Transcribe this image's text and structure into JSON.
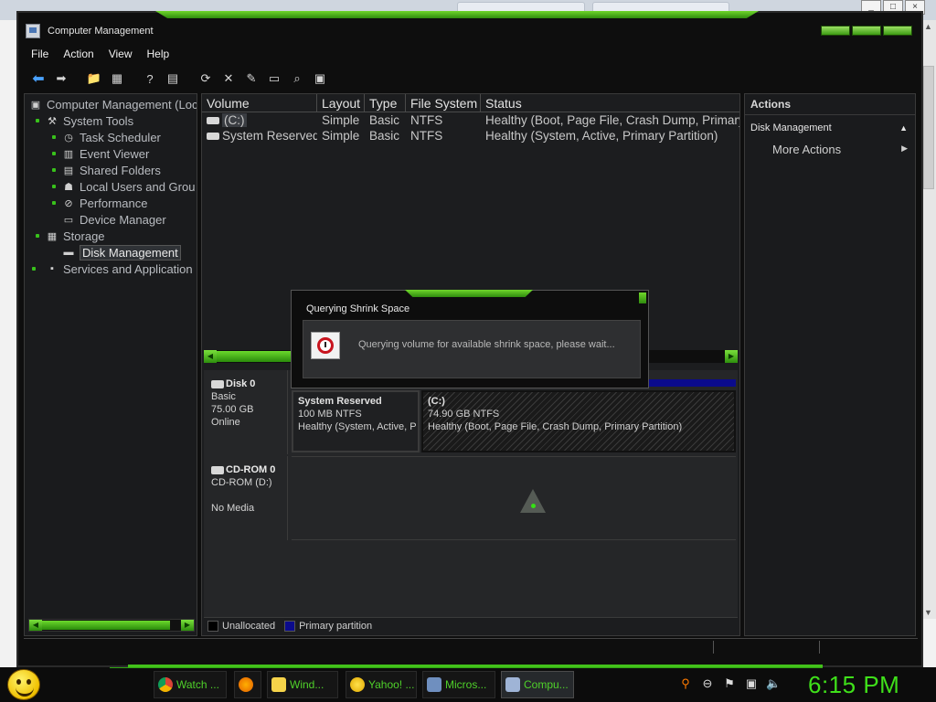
{
  "window": {
    "title": "Computer Management"
  },
  "menu": [
    "File",
    "Action",
    "View",
    "Help"
  ],
  "toolbar": {
    "icons": [
      "back-icon",
      "forward-icon",
      "folder-up-icon",
      "show-hide-tree-icon",
      "help-icon",
      "properties-icon",
      "refresh-icon",
      "delete-icon",
      "wizard-icon",
      "open-folder-icon",
      "search-icon",
      "export-icon"
    ]
  },
  "tree": {
    "root": "Computer Management (Loc",
    "items": [
      {
        "label": "System Tools",
        "icon": "tools-icon"
      },
      {
        "label": "Task Scheduler",
        "icon": "clock-icon"
      },
      {
        "label": "Event Viewer",
        "icon": "event-viewer-icon"
      },
      {
        "label": "Shared Folders",
        "icon": "shared-folder-icon"
      },
      {
        "label": "Local Users and Grou",
        "icon": "users-icon"
      },
      {
        "label": "Performance",
        "icon": "performance-icon"
      },
      {
        "label": "Device Manager",
        "icon": "device-manager-icon"
      },
      {
        "label": "Storage",
        "icon": "storage-icon"
      },
      {
        "label": "Disk Management",
        "icon": "disk-icon"
      },
      {
        "label": "Services and Application",
        "icon": "services-icon"
      }
    ]
  },
  "volumes": {
    "columns": [
      "Volume",
      "Layout",
      "Type",
      "File System",
      "Status"
    ],
    "rows": [
      {
        "volume": "(C:)",
        "layout": "Simple",
        "type": "Basic",
        "fs": "NTFS",
        "status": "Healthy (Boot, Page File, Crash Dump, Primary"
      },
      {
        "volume": "System Reserved",
        "layout": "Simple",
        "type": "Basic",
        "fs": "NTFS",
        "status": "Healthy (System, Active, Primary Partition)"
      }
    ]
  },
  "disks": {
    "disk0": {
      "name": "Disk 0",
      "type": "Basic",
      "size": "75.00 GB",
      "state": "Online",
      "partitions": [
        {
          "name": "System Reserved",
          "size": "100 MB NTFS",
          "status": "Healthy (System, Active, P"
        },
        {
          "name": "(C:)",
          "size": "74.90 GB NTFS",
          "status": "Healthy (Boot, Page File, Crash Dump, Primary Partition)"
        }
      ]
    },
    "cdrom0": {
      "name": "CD-ROM 0",
      "drive": "CD-ROM (D:)",
      "media": "No Media"
    }
  },
  "legend": [
    {
      "label": "Unallocated",
      "color": "#000000"
    },
    {
      "label": "Primary partition",
      "color": "#0b0b8c"
    }
  ],
  "actions": {
    "header": "Actions",
    "section": "Disk Management",
    "more": "More Actions"
  },
  "dialog": {
    "title": "Querying Shrink Space",
    "message": "Querying volume for available shrink space, please wait..."
  },
  "taskbar": {
    "buttons": [
      {
        "label": "Watch ...",
        "icon": "chrome-icon"
      },
      {
        "label": "",
        "icon": "firefox-icon"
      },
      {
        "label": "Wind...",
        "icon": "folder-icon"
      },
      {
        "label": "Yahoo! ...",
        "icon": "yahoo-icon"
      },
      {
        "label": "Micros...",
        "icon": "microsoft-icon"
      },
      {
        "label": "Compu...",
        "icon": "computer-management-icon"
      }
    ],
    "clock": "6:15 PM"
  },
  "colors": {
    "accent": "#3fe01a",
    "primary_partition": "#0b0b8c"
  }
}
